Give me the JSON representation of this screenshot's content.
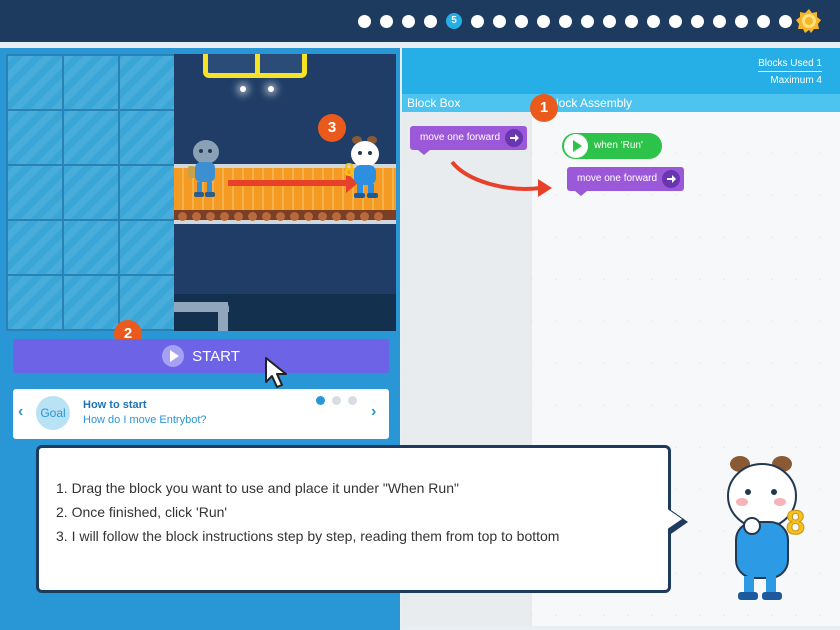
{
  "progress": {
    "current_step": "5",
    "dots_before": 4,
    "dots_after": 16
  },
  "stage": {
    "badge_stage": "3",
    "badge_start": "2"
  },
  "start_button": {
    "label": "START"
  },
  "goal": {
    "bubble": "Goal",
    "title": "How to start",
    "subtitle": "How do I move Entrybot?"
  },
  "workspace": {
    "blocks_used": "Blocks Used 1",
    "maximum": "Maximum 4",
    "tab_block_box": "Block  Box",
    "tab_assembly": "Block Assembly",
    "badge_assembly": "1",
    "palette_block": "move one forward",
    "start_block": "when 'Run'",
    "assembled_block": "move one forward"
  },
  "dialog": {
    "line1": "1. Drag the block you want to use and place it under \"When Run\"",
    "line2": "2. Once finished, click 'Run'",
    "line3": "3. I will follow the block instructions step by step, reading them from top to bottom"
  },
  "colors": {
    "topbar": "#1d3a5f",
    "panel_blue": "#2996d6",
    "start_purple": "#6c63e6",
    "block_purple": "#9b59d9",
    "when_run_green": "#2dc24a",
    "badge_orange": "#ea5a1c",
    "arrow_red": "#e8412a"
  }
}
